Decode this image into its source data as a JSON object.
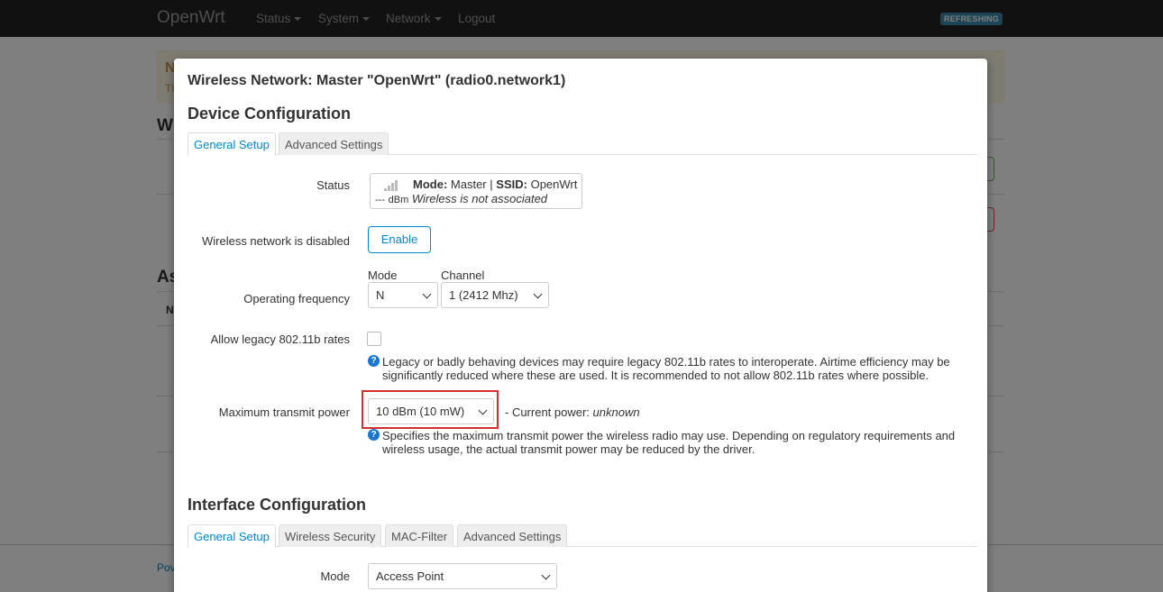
{
  "navbar": {
    "brand": "OpenWrt",
    "menu": [
      {
        "label": "Status"
      },
      {
        "label": "System"
      },
      {
        "label": "Network"
      },
      {
        "label": "Logout"
      }
    ],
    "refresh_badge": "REFRESHING"
  },
  "background": {
    "alert_title": "N",
    "alert_text": "Th",
    "heading1": "Wi",
    "heading2": "As",
    "table_header": "N",
    "footer": "Pov"
  },
  "modal": {
    "title": "Wireless Network: Master \"OpenWrt\" (radio0.network1)",
    "device_section": {
      "title": "Device Configuration",
      "tabs": [
        {
          "label": "General Setup",
          "active": true
        },
        {
          "label": "Advanced Settings",
          "active": false
        }
      ],
      "status": {
        "label": "Status",
        "mode_key": "Mode:",
        "mode_value": "Master",
        "sep": "|",
        "ssid_key": "SSID:",
        "ssid_value": "OpenWrt",
        "signal": "---",
        "signal_unit": "dBm",
        "assoc": "Wireless is not associated"
      },
      "disabled": {
        "label": "Wireless network is disabled",
        "button": "Enable"
      },
      "frequency": {
        "label": "Operating frequency",
        "mode_label": "Mode",
        "mode_value": "N",
        "channel_label": "Channel",
        "channel_value": "1 (2412 Mhz)"
      },
      "legacy": {
        "label": "Allow legacy 802.11b rates",
        "checked": false,
        "help": "Legacy or badly behaving devices may require legacy 802.11b rates to interoperate. Airtime efficiency may be significantly reduced where these are used. It is recommended to not allow 802.11b rates where possible."
      },
      "txpower": {
        "label": "Maximum transmit power",
        "value": "10 dBm (10 mW)",
        "current_prefix": "- Current power:",
        "current_value": "unknown",
        "help": "Specifies the maximum transmit power the wireless radio may use. Depending on regulatory requirements and wireless usage, the actual transmit power may be reduced by the driver."
      }
    },
    "interface_section": {
      "title": "Interface Configuration",
      "tabs": [
        {
          "label": "General Setup",
          "active": true
        },
        {
          "label": "Wireless Security",
          "active": false
        },
        {
          "label": "MAC-Filter",
          "active": false
        },
        {
          "label": "Advanced Settings",
          "active": false
        }
      ],
      "mode": {
        "label": "Mode",
        "value": "Access Point"
      }
    }
  },
  "colors": {
    "accent": "#0088cc",
    "highlight": "#d32f2f",
    "help_icon": "#1976d2"
  }
}
